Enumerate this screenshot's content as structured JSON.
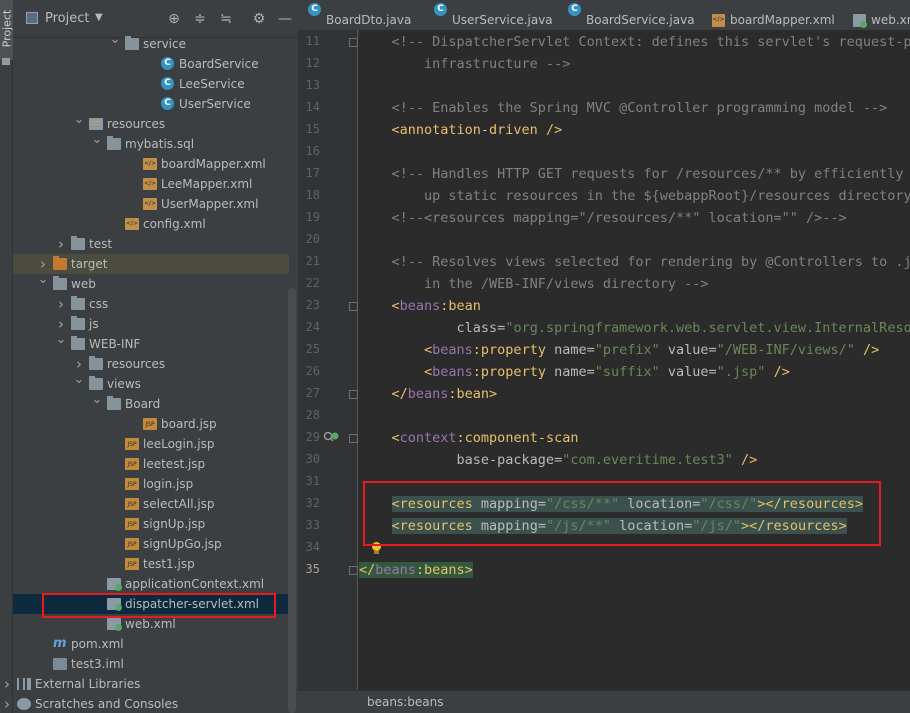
{
  "toolwindow_strip": {
    "project_tab_label": "Project"
  },
  "project_panel": {
    "title": "Project",
    "header_buttons": [
      "locate-icon",
      "expand-all-icon",
      "collapse-all-icon",
      "gear-icon",
      "hide-icon"
    ]
  },
  "tree": [
    {
      "label": "service",
      "arrow": "expanded",
      "icon": "package-folder-icon",
      "depth": 6
    },
    {
      "label": "BoardService",
      "arrow": "",
      "icon": "class-icon",
      "depth": 8
    },
    {
      "label": "LeeService",
      "arrow": "",
      "icon": "class-icon",
      "depth": 8
    },
    {
      "label": "UserService",
      "arrow": "",
      "icon": "class-icon",
      "depth": 8
    },
    {
      "label": "resources",
      "arrow": "expanded",
      "icon": "resources-folder-icon",
      "depth": 4
    },
    {
      "label": "mybatis.sql",
      "arrow": "expanded",
      "icon": "folder-icon",
      "depth": 5
    },
    {
      "label": "boardMapper.xml",
      "arrow": "",
      "icon": "xml-icon",
      "depth": 7
    },
    {
      "label": "LeeMapper.xml",
      "arrow": "",
      "icon": "xml-icon",
      "depth": 7
    },
    {
      "label": "UserMapper.xml",
      "arrow": "",
      "icon": "xml-icon",
      "depth": 7
    },
    {
      "label": "config.xml",
      "arrow": "",
      "icon": "xml-icon",
      "depth": 6
    },
    {
      "label": "test",
      "arrow": "collapsed",
      "icon": "folder-icon",
      "depth": 3
    },
    {
      "label": "target",
      "arrow": "collapsed",
      "icon": "excluded-folder-icon",
      "depth": 2
    },
    {
      "label": "web",
      "arrow": "expanded",
      "icon": "web-folder-icon",
      "depth": 2
    },
    {
      "label": "css",
      "arrow": "collapsed",
      "icon": "folder-icon",
      "depth": 3
    },
    {
      "label": "js",
      "arrow": "collapsed",
      "icon": "folder-icon",
      "depth": 3
    },
    {
      "label": "WEB-INF",
      "arrow": "expanded",
      "icon": "folder-icon",
      "depth": 3
    },
    {
      "label": "resources",
      "arrow": "collapsed",
      "icon": "folder-icon",
      "depth": 4
    },
    {
      "label": "views",
      "arrow": "expanded",
      "icon": "folder-icon",
      "depth": 4
    },
    {
      "label": "Board",
      "arrow": "expanded",
      "icon": "folder-icon",
      "depth": 5
    },
    {
      "label": "board.jsp",
      "arrow": "",
      "icon": "jsp-icon",
      "depth": 7
    },
    {
      "label": "leeLogin.jsp",
      "arrow": "",
      "icon": "jsp-icon",
      "depth": 6
    },
    {
      "label": "leetest.jsp",
      "arrow": "",
      "icon": "jsp-icon",
      "depth": 6
    },
    {
      "label": "login.jsp",
      "arrow": "",
      "icon": "jsp-icon",
      "depth": 6
    },
    {
      "label": "selectAll.jsp",
      "arrow": "",
      "icon": "jsp-icon",
      "depth": 6
    },
    {
      "label": "signUp.jsp",
      "arrow": "",
      "icon": "jsp-icon",
      "depth": 6
    },
    {
      "label": "signUpGo.jsp",
      "arrow": "",
      "icon": "jsp-icon",
      "depth": 6
    },
    {
      "label": "test1.jsp",
      "arrow": "",
      "icon": "jsp-icon",
      "depth": 6
    },
    {
      "label": "applicationContext.xml",
      "arrow": "",
      "icon": "spring-xml-icon",
      "depth": 5
    },
    {
      "label": "dispatcher-servlet.xml",
      "arrow": "",
      "icon": "spring-xml-icon",
      "depth": 5,
      "selected": true
    },
    {
      "label": "web.xml",
      "arrow": "",
      "icon": "web-xml-icon",
      "depth": 5
    },
    {
      "label": "pom.xml",
      "arrow": "",
      "icon": "maven-icon",
      "depth": 2
    },
    {
      "label": "test3.iml",
      "arrow": "",
      "icon": "iml-icon",
      "depth": 2
    },
    {
      "label": "External Libraries",
      "arrow": "collapsed",
      "icon": "libraries-icon",
      "depth": 0
    },
    {
      "label": "Scratches and Consoles",
      "arrow": "collapsed",
      "icon": "scratches-icon",
      "depth": 0
    }
  ],
  "tabs": [
    {
      "label": "BoardDto.java",
      "icon": "class-icon"
    },
    {
      "label": "UserService.java",
      "icon": "class-icon"
    },
    {
      "label": "BoardService.java",
      "icon": "class-icon"
    },
    {
      "label": "boardMapper.xml",
      "icon": "xml-icon"
    },
    {
      "label": "web.xm",
      "icon": "web-xml-icon"
    }
  ],
  "editor": {
    "line_numbers": [
      "11",
      "12",
      "13",
      "14",
      "15",
      "16",
      "17",
      "18",
      "19",
      "20",
      "21",
      "22",
      "23",
      "24",
      "25",
      "26",
      "27",
      "28",
      "29",
      "30",
      "31",
      "32",
      "33",
      "34",
      "35"
    ],
    "current_line": "35",
    "lines": [
      [
        {
          "c": "c",
          "t": "    <!-- DispatcherServlet Context: defines this servlet's request-processing"
        }
      ],
      [
        {
          "c": "c",
          "t": "        infrastructure -->"
        }
      ],
      [
        {
          "c": "a",
          "t": ""
        }
      ],
      [
        {
          "c": "c",
          "t": "    <!-- Enables the Spring MVC @Controller programming model -->"
        }
      ],
      [
        {
          "c": "t",
          "t": "    <"
        },
        {
          "c": "p",
          "t": "annotation-driven"
        },
        {
          "c": "t",
          "t": " />"
        }
      ],
      [
        {
          "c": "a",
          "t": ""
        }
      ],
      [
        {
          "c": "c",
          "t": "    <!-- Handles HTTP GET requests for /resources/** by efficiently serving"
        }
      ],
      [
        {
          "c": "c",
          "t": "        up static resources in the ${webappRoot}/resources directory -->"
        }
      ],
      [
        {
          "c": "c",
          "t": "    <!--<resources mapping=\"/resources/**\" location=\"\" />-->"
        }
      ],
      [
        {
          "c": "a",
          "t": ""
        }
      ],
      [
        {
          "c": "c",
          "t": "    <!-- Resolves views selected for rendering by @Controllers to .jsp resources"
        }
      ],
      [
        {
          "c": "c",
          "t": "        in the /WEB-INF/views directory -->"
        }
      ],
      [
        {
          "c": "t",
          "t": "    <"
        },
        {
          "c": "ns",
          "t": "beans"
        },
        {
          "c": "t",
          "t": ":bean"
        }
      ],
      [
        {
          "c": "a",
          "t": "            class="
        },
        {
          "c": "v",
          "t": "\"org.springframework.web.servlet.view.InternalResourceViewResolver\""
        }
      ],
      [
        {
          "c": "t",
          "t": "        <"
        },
        {
          "c": "ns",
          "t": "beans"
        },
        {
          "c": "t",
          "t": ":property "
        },
        {
          "c": "a",
          "t": "name="
        },
        {
          "c": "v",
          "t": "\"prefix\" "
        },
        {
          "c": "a",
          "t": "value="
        },
        {
          "c": "v",
          "t": "\"/WEB-INF/views/\" "
        },
        {
          "c": "t",
          "t": "/>"
        }
      ],
      [
        {
          "c": "t",
          "t": "        <"
        },
        {
          "c": "ns",
          "t": "beans"
        },
        {
          "c": "t",
          "t": ":property "
        },
        {
          "c": "a",
          "t": "name="
        },
        {
          "c": "v",
          "t": "\"suffix\" "
        },
        {
          "c": "a",
          "t": "value="
        },
        {
          "c": "v",
          "t": "\".jsp\" "
        },
        {
          "c": "t",
          "t": "/>"
        }
      ],
      [
        {
          "c": "t",
          "t": "    </"
        },
        {
          "c": "ns",
          "t": "beans"
        },
        {
          "c": "t",
          "t": ":bean>"
        }
      ],
      [
        {
          "c": "a",
          "t": ""
        }
      ],
      [
        {
          "c": "t",
          "t": "    <"
        },
        {
          "c": "ns",
          "t": "context"
        },
        {
          "c": "t",
          "t": ":component-scan"
        }
      ],
      [
        {
          "c": "a",
          "t": "            base-package="
        },
        {
          "c": "v",
          "t": "\"com.everitime.test3\" "
        },
        {
          "c": "t",
          "t": "/>"
        }
      ],
      [
        {
          "c": "a",
          "t": ""
        }
      ],
      [
        {
          "c": "t",
          "t": "    <resources "
        },
        {
          "c": "a",
          "t": "mapping="
        },
        {
          "c": "v",
          "t": "\"/css/**\" "
        },
        {
          "c": "a",
          "t": "location="
        },
        {
          "c": "v",
          "t": "\"/css/\""
        },
        {
          "c": "t",
          "t": "></resources>"
        }
      ],
      [
        {
          "c": "t",
          "t": "    <resources "
        },
        {
          "c": "a",
          "t": "mapping="
        },
        {
          "c": "v",
          "t": "\"/js/**\" "
        },
        {
          "c": "a",
          "t": "location="
        },
        {
          "c": "v",
          "t": "\"/js/\""
        },
        {
          "c": "t",
          "t": "></resources>"
        }
      ],
      [
        {
          "c": "a",
          "t": ""
        }
      ],
      [
        {
          "c": "t",
          "t": "</"
        },
        {
          "c": "ns",
          "t": "beans"
        },
        {
          "c": "t",
          "t": ":beans>"
        }
      ]
    ]
  },
  "statusbar": {
    "breadcrumb": "beans:beans"
  },
  "colors": {
    "panel_bg": "#3c3f41",
    "editor_bg": "#2b2b2b",
    "annotation_red": "#e81c1c",
    "selection_blue": "#0d293e"
  }
}
